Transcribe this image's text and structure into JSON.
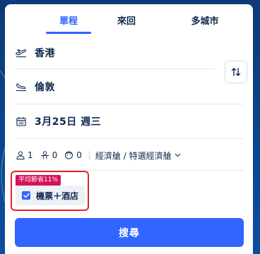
{
  "tabs": [
    {
      "label": "單程",
      "active": true
    },
    {
      "label": "來回",
      "active": false
    },
    {
      "label": "多城市",
      "active": false
    }
  ],
  "origin": {
    "city": "香港",
    "icon": "takeoff-icon"
  },
  "destination": {
    "city": "倫敦",
    "icon": "landing-icon"
  },
  "swap": {
    "icon": "swap-arrows-icon"
  },
  "date": {
    "text": "3月25日 週三",
    "icon": "calendar-icon"
  },
  "passengers": {
    "adults": "1",
    "children": "0",
    "infants": "0",
    "cabin": "經濟艙 / 特選經濟艙"
  },
  "bundle": {
    "badge": "平均節省11%",
    "label": "機票＋酒店",
    "checked": true
  },
  "search_button": "搜尋",
  "colors": {
    "accent": "#3264ff",
    "badge": "#d4145a",
    "highlight_border": "#e0262b",
    "text": "#0f294d"
  }
}
